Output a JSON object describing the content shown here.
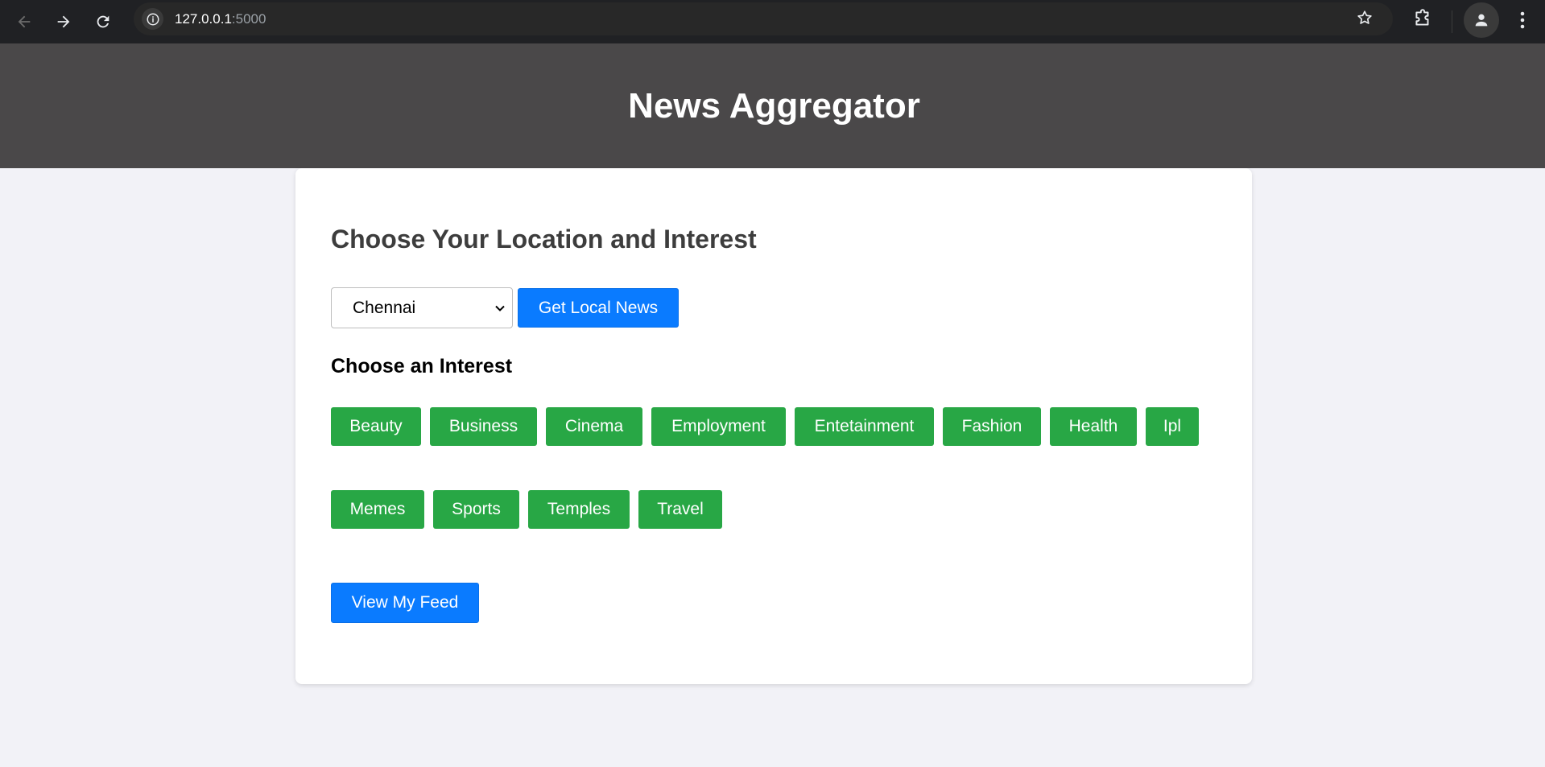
{
  "browser": {
    "url_host": "127.0.0.1",
    "url_port": ":5000"
  },
  "header": {
    "title": "News Aggregator"
  },
  "main": {
    "heading": "Choose Your Location and Interest",
    "location_select": {
      "value": "Chennai"
    },
    "local_news_button": "Get Local News",
    "interest_heading": "Choose an Interest",
    "interests": [
      "Beauty",
      "Business",
      "Cinema",
      "Employment",
      "Entetainment",
      "Fashion",
      "Health",
      "Ipl",
      "Memes",
      "Sports",
      "Temples",
      "Travel"
    ],
    "feed_button": "View My Feed"
  },
  "colors": {
    "header_bg": "#4a4849",
    "page_bg": "#f2f2f7",
    "primary_blue": "#0a7bff",
    "interest_green": "#28a745"
  },
  "icons": [
    "back-icon",
    "forward-icon",
    "reload-icon",
    "site-info-icon",
    "bookmark-star-icon",
    "extensions-icon",
    "profile-icon",
    "more-menu-icon",
    "chevron-down-icon"
  ]
}
